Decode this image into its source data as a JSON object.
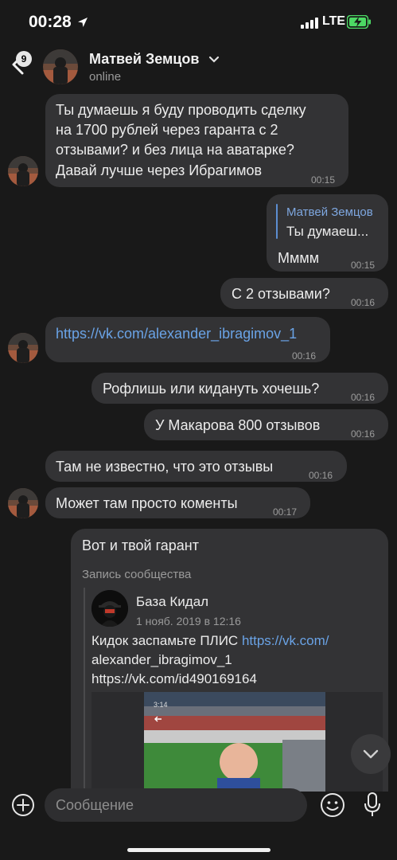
{
  "status_bar": {
    "time": "00:28",
    "network": "LTE"
  },
  "header": {
    "back_badge": "9",
    "name": "Матвей Земцов",
    "status": "online"
  },
  "messages": [
    {
      "lines": [
        "Ты думаешь я буду проводить сделку",
        "на 1700 рублей через гаранта с 2",
        "отзывами? и без лица на аватарке?",
        "Давай лучше через Ибрагимов"
      ],
      "time": "00:15"
    },
    {
      "reply_name": "Матвей Земцов",
      "reply_text": "Ты думаеш...",
      "text": "Мммм",
      "time": "00:15"
    },
    {
      "text": "С 2 отзывами?",
      "time": "00:16"
    },
    {
      "text": "https://vk.com/alexander_ibragimov_1",
      "time": "00:16"
    },
    {
      "text": "Рофлишь или кидануть хочешь?",
      "time": "00:16"
    },
    {
      "text": "У Макарова 800 отзывов",
      "time": "00:16"
    },
    {
      "text": "Там не известно, что это отзывы",
      "time": "00:16"
    },
    {
      "text": "Может там просто коменты",
      "time": "00:17"
    }
  ],
  "repost": {
    "text": "Вот и твой гарант",
    "label": "Запись сообщества",
    "group_name": "База Кидал",
    "date": "1 нояб. 2019 в 12:16",
    "post_prefix": "Кидок заспамьте ПЛИС ",
    "link1_part1": "https://vk.com/",
    "link1_part2": "alexander_ibragimov_1",
    "link2": "https://vk.com/id490169164",
    "media_time": "3:14"
  },
  "composer": {
    "placeholder": "Сообщение"
  },
  "colors": {
    "bubble": "#333335",
    "link": "#6aa3e6",
    "background": "#191919",
    "battery": "#4cd964"
  }
}
